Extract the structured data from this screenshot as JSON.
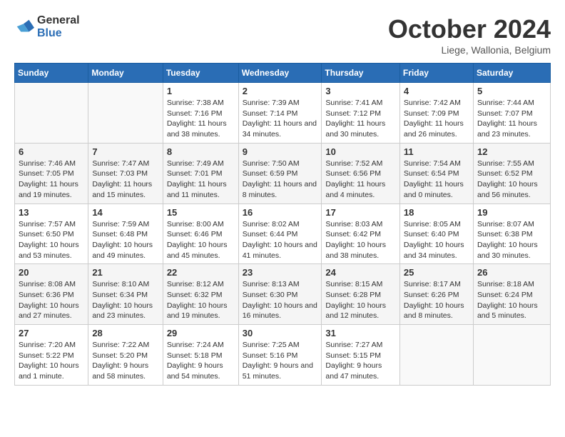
{
  "header": {
    "logo_general": "General",
    "logo_blue": "Blue",
    "month_title": "October 2024",
    "subtitle": "Liege, Wallonia, Belgium"
  },
  "days_of_week": [
    "Sunday",
    "Monday",
    "Tuesday",
    "Wednesday",
    "Thursday",
    "Friday",
    "Saturday"
  ],
  "weeks": [
    [
      {
        "day": "",
        "info": ""
      },
      {
        "day": "",
        "info": ""
      },
      {
        "day": "1",
        "info": "Sunrise: 7:38 AM\nSunset: 7:16 PM\nDaylight: 11 hours and 38 minutes."
      },
      {
        "day": "2",
        "info": "Sunrise: 7:39 AM\nSunset: 7:14 PM\nDaylight: 11 hours and 34 minutes."
      },
      {
        "day": "3",
        "info": "Sunrise: 7:41 AM\nSunset: 7:12 PM\nDaylight: 11 hours and 30 minutes."
      },
      {
        "day": "4",
        "info": "Sunrise: 7:42 AM\nSunset: 7:09 PM\nDaylight: 11 hours and 26 minutes."
      },
      {
        "day": "5",
        "info": "Sunrise: 7:44 AM\nSunset: 7:07 PM\nDaylight: 11 hours and 23 minutes."
      }
    ],
    [
      {
        "day": "6",
        "info": "Sunrise: 7:46 AM\nSunset: 7:05 PM\nDaylight: 11 hours and 19 minutes."
      },
      {
        "day": "7",
        "info": "Sunrise: 7:47 AM\nSunset: 7:03 PM\nDaylight: 11 hours and 15 minutes."
      },
      {
        "day": "8",
        "info": "Sunrise: 7:49 AM\nSunset: 7:01 PM\nDaylight: 11 hours and 11 minutes."
      },
      {
        "day": "9",
        "info": "Sunrise: 7:50 AM\nSunset: 6:59 PM\nDaylight: 11 hours and 8 minutes."
      },
      {
        "day": "10",
        "info": "Sunrise: 7:52 AM\nSunset: 6:56 PM\nDaylight: 11 hours and 4 minutes."
      },
      {
        "day": "11",
        "info": "Sunrise: 7:54 AM\nSunset: 6:54 PM\nDaylight: 11 hours and 0 minutes."
      },
      {
        "day": "12",
        "info": "Sunrise: 7:55 AM\nSunset: 6:52 PM\nDaylight: 10 hours and 56 minutes."
      }
    ],
    [
      {
        "day": "13",
        "info": "Sunrise: 7:57 AM\nSunset: 6:50 PM\nDaylight: 10 hours and 53 minutes."
      },
      {
        "day": "14",
        "info": "Sunrise: 7:59 AM\nSunset: 6:48 PM\nDaylight: 10 hours and 49 minutes."
      },
      {
        "day": "15",
        "info": "Sunrise: 8:00 AM\nSunset: 6:46 PM\nDaylight: 10 hours and 45 minutes."
      },
      {
        "day": "16",
        "info": "Sunrise: 8:02 AM\nSunset: 6:44 PM\nDaylight: 10 hours and 41 minutes."
      },
      {
        "day": "17",
        "info": "Sunrise: 8:03 AM\nSunset: 6:42 PM\nDaylight: 10 hours and 38 minutes."
      },
      {
        "day": "18",
        "info": "Sunrise: 8:05 AM\nSunset: 6:40 PM\nDaylight: 10 hours and 34 minutes."
      },
      {
        "day": "19",
        "info": "Sunrise: 8:07 AM\nSunset: 6:38 PM\nDaylight: 10 hours and 30 minutes."
      }
    ],
    [
      {
        "day": "20",
        "info": "Sunrise: 8:08 AM\nSunset: 6:36 PM\nDaylight: 10 hours and 27 minutes."
      },
      {
        "day": "21",
        "info": "Sunrise: 8:10 AM\nSunset: 6:34 PM\nDaylight: 10 hours and 23 minutes."
      },
      {
        "day": "22",
        "info": "Sunrise: 8:12 AM\nSunset: 6:32 PM\nDaylight: 10 hours and 19 minutes."
      },
      {
        "day": "23",
        "info": "Sunrise: 8:13 AM\nSunset: 6:30 PM\nDaylight: 10 hours and 16 minutes."
      },
      {
        "day": "24",
        "info": "Sunrise: 8:15 AM\nSunset: 6:28 PM\nDaylight: 10 hours and 12 minutes."
      },
      {
        "day": "25",
        "info": "Sunrise: 8:17 AM\nSunset: 6:26 PM\nDaylight: 10 hours and 8 minutes."
      },
      {
        "day": "26",
        "info": "Sunrise: 8:18 AM\nSunset: 6:24 PM\nDaylight: 10 hours and 5 minutes."
      }
    ],
    [
      {
        "day": "27",
        "info": "Sunrise: 7:20 AM\nSunset: 5:22 PM\nDaylight: 10 hours and 1 minute."
      },
      {
        "day": "28",
        "info": "Sunrise: 7:22 AM\nSunset: 5:20 PM\nDaylight: 9 hours and 58 minutes."
      },
      {
        "day": "29",
        "info": "Sunrise: 7:24 AM\nSunset: 5:18 PM\nDaylight: 9 hours and 54 minutes."
      },
      {
        "day": "30",
        "info": "Sunrise: 7:25 AM\nSunset: 5:16 PM\nDaylight: 9 hours and 51 minutes."
      },
      {
        "day": "31",
        "info": "Sunrise: 7:27 AM\nSunset: 5:15 PM\nDaylight: 9 hours and 47 minutes."
      },
      {
        "day": "",
        "info": ""
      },
      {
        "day": "",
        "info": ""
      }
    ]
  ]
}
